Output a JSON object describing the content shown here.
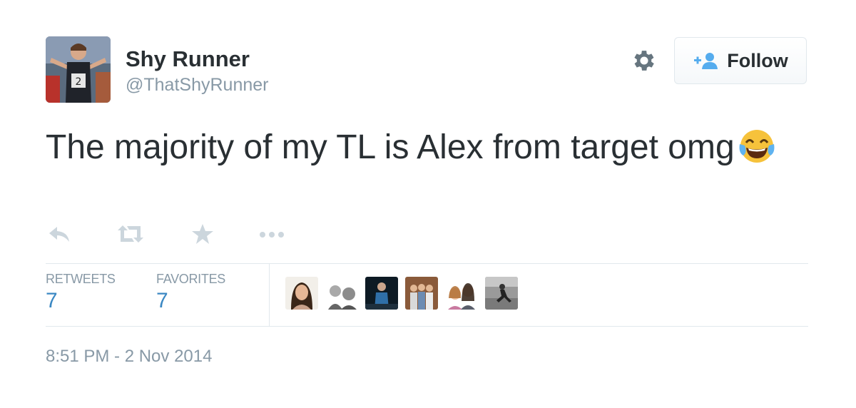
{
  "author": {
    "name": "Shy Runner",
    "handle": "@ThatShyRunner",
    "avatar": "avatar-runner-photo"
  },
  "header": {
    "settings_icon": "gear-icon",
    "follow_label": "Follow",
    "follow_icon": "add-user-icon"
  },
  "tweet": {
    "text": "The majority of my TL is Alex from target omg",
    "emoji": "face-with-tears-of-joy"
  },
  "actions": [
    "reply-icon",
    "retweet-icon",
    "favorite-star-icon",
    "more-ellipsis-icon"
  ],
  "stats": {
    "retweets_label": "RETWEETS",
    "retweets_count": "7",
    "favorites_label": "FAVORITES",
    "favorites_count": "7"
  },
  "favorited_by": [
    "user-avatar-1",
    "user-avatar-2",
    "user-avatar-3",
    "user-avatar-4",
    "user-avatar-5",
    "user-avatar-6"
  ],
  "timestamp": "8:51 PM - 2 Nov 2014",
  "colors": {
    "text": "#292f33",
    "muted": "#8899a6",
    "link": "#3b88c3",
    "follow_icon": "#55acee",
    "divider": "#e1e8ed"
  }
}
